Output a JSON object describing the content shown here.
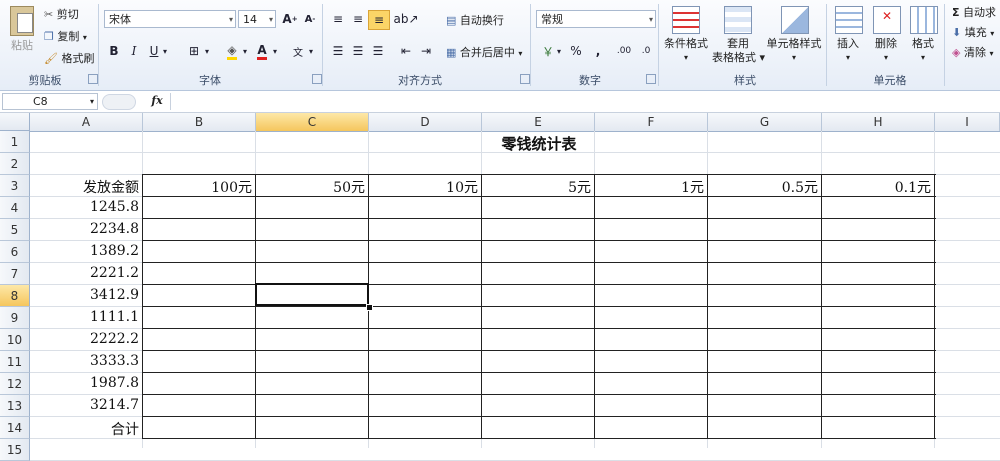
{
  "ribbon": {
    "clipboard": {
      "paste": "粘贴",
      "cut": "剪切",
      "copy": "复制",
      "format_painter": "格式刷",
      "group_label": "剪贴板"
    },
    "font": {
      "font_name": "宋体",
      "font_size": "14",
      "bold": "B",
      "italic": "I",
      "underline": "U",
      "group_label": "字体"
    },
    "alignment": {
      "wrap_text": "自动换行",
      "merge_center": "合并后居中",
      "group_label": "对齐方式"
    },
    "number": {
      "format": "常规",
      "percent": "%",
      "comma": ",",
      "group_label": "数字"
    },
    "styles": {
      "conditional": "条件格式",
      "table_format_1": "套用",
      "table_format_2": "表格格式",
      "cell_styles": "单元格样式",
      "group_label": "样式"
    },
    "cells": {
      "insert": "插入",
      "delete": "删除",
      "format": "格式",
      "group_label": "单元格"
    },
    "editing": {
      "autosum": "自动求",
      "fill": "填充",
      "clear": "清除"
    }
  },
  "formula_bar": {
    "name_box": "C8",
    "fx": "fx",
    "content": ""
  },
  "grid": {
    "columns": [
      "A",
      "B",
      "C",
      "D",
      "E",
      "F",
      "G",
      "H",
      "I"
    ],
    "selected_column": "C",
    "rows": [
      "1",
      "2",
      "3",
      "4",
      "5",
      "6",
      "7",
      "8",
      "9",
      "10",
      "11",
      "12",
      "13",
      "14",
      "15"
    ],
    "selected_row": "8",
    "title": "零钱统计表",
    "header_a": "发放金额",
    "denominations": [
      "100元",
      "50元",
      "10元",
      "5元",
      "1元",
      "0.5元",
      "0.1元"
    ],
    "amounts": [
      "1245.8",
      "2234.8",
      "1389.2",
      "2221.2",
      "3412.9",
      "1111.1",
      "2222.2",
      "3333.3",
      "1987.8",
      "3214.7"
    ],
    "total_label": "合计"
  }
}
